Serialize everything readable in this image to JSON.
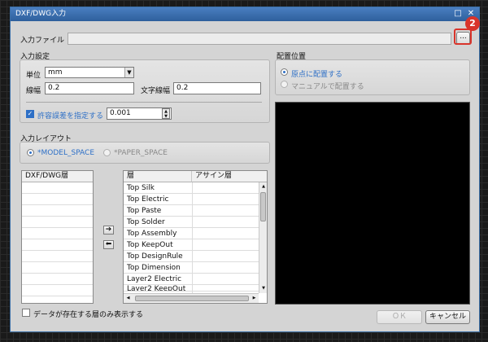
{
  "dialog": {
    "title": "DXF/DWG入力",
    "restore_glyph": "□",
    "close_glyph": "✕"
  },
  "input_file": {
    "label": "入力ファイル",
    "value": "",
    "browse_label": "..."
  },
  "annotation": {
    "step_number": "2"
  },
  "input_settings": {
    "heading": "入力設定",
    "unit_label": "単位",
    "unit_value": "mm",
    "line_width_label": "線幅",
    "line_width_value": "0.2",
    "text_line_width_label": "文字線幅",
    "text_line_width_value": "0.2",
    "tolerance_checkbox_label": "許容誤差を指定する",
    "tolerance_checked": true,
    "tolerance_value": "0.001"
  },
  "input_layout": {
    "heading": "入力レイアウト",
    "options": [
      {
        "label": "*MODEL_SPACE",
        "selected": true
      },
      {
        "label": "*PAPER_SPACE",
        "selected": false
      }
    ]
  },
  "placement": {
    "heading": "配置位置",
    "options": [
      {
        "label": "原点に配置する",
        "selected": true
      },
      {
        "label": "マニュアルで配置する",
        "selected": false
      }
    ]
  },
  "dxf_layers_table": {
    "header": "DXF/DWG層",
    "rows": []
  },
  "move_buttons": {
    "assign_glyph": "➔",
    "unassign_glyph": "⬅"
  },
  "layers_table": {
    "headers": [
      "層",
      "アサイン層"
    ],
    "rows": [
      [
        "Top Silk",
        ""
      ],
      [
        "Top Electric",
        ""
      ],
      [
        "Top Paste",
        ""
      ],
      [
        "Top Solder",
        ""
      ],
      [
        "Top Assembly",
        ""
      ],
      [
        "Top KeepOut",
        ""
      ],
      [
        "Top DesignRule",
        ""
      ],
      [
        "Top Dimension",
        ""
      ],
      [
        "Layer2 Electric",
        ""
      ],
      [
        "Layer2 KeepOut",
        ""
      ]
    ]
  },
  "footer": {
    "show_only_existing_label": "データが存在する層のみ表示する",
    "show_only_existing_checked": false,
    "ok_label": "ＯＫ",
    "cancel_label": "キャンセル"
  }
}
